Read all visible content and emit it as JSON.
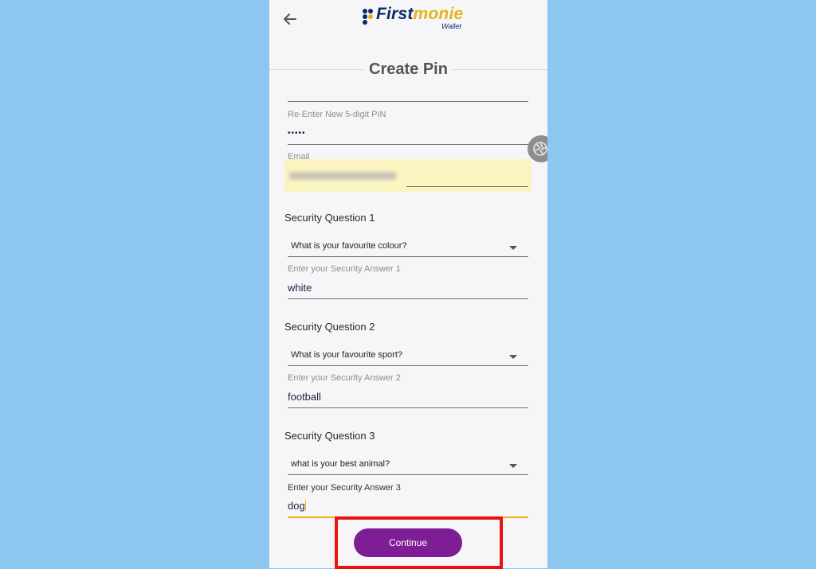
{
  "header": {
    "logo_primary": "First",
    "logo_secondary": "monie",
    "logo_sub": "Wallet",
    "title": "Create Pin"
  },
  "pin": {
    "reenter_label": "Re-Enter New 5-digit PIN",
    "reenter_value": "•••••"
  },
  "email": {
    "label": "Email"
  },
  "questions": [
    {
      "heading": "Security Question 1",
      "selected": "What is your favourite colour?",
      "answer_label": "Enter your Security Answer 1",
      "answer": "white"
    },
    {
      "heading": "Security Question 2",
      "selected": "What is your favourite sport?",
      "answer_label": "Enter your Security Answer 2",
      "answer": "football"
    },
    {
      "heading": "Security Question 3",
      "selected": "what is your best animal?",
      "answer_label": "Enter your Security Answer 3",
      "answer": "dog"
    }
  ],
  "actions": {
    "continue_label": "Continue"
  },
  "colors": {
    "background": "#8ec6f2",
    "brand_navy": "#0b2a6e",
    "brand_gold": "#e8b21b",
    "button_purple": "#7e1d96",
    "highlight_red": "#ee1111"
  },
  "icons": {
    "back": "arrow-left-icon",
    "floating": "aperture-icon",
    "dropdown": "caret-down-icon"
  }
}
